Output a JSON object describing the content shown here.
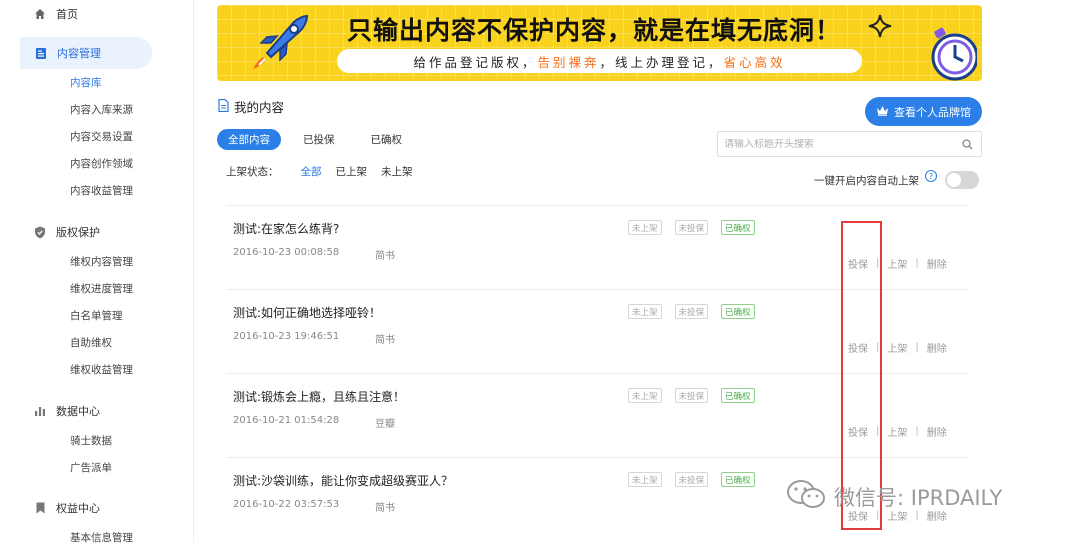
{
  "sidebar": {
    "groups": [
      {
        "label": "首页",
        "icon": "home-icon",
        "items": []
      },
      {
        "label": "内容管理",
        "icon": "document-icon",
        "active": true,
        "items": [
          "内容库",
          "内容入库来源",
          "内容交易设置",
          "内容创作领域",
          "内容收益管理"
        ]
      },
      {
        "label": "版权保护",
        "icon": "shield-icon",
        "items": [
          "维权内容管理",
          "维权进度管理",
          "白名单管理",
          "自助维权",
          "维权收益管理"
        ]
      },
      {
        "label": "数据中心",
        "icon": "bar-chart-icon",
        "items": [
          "骑士数据",
          "广告派单"
        ]
      },
      {
        "label": "权益中心",
        "icon": "bookmark-icon",
        "items": [
          "基本信息管理"
        ]
      }
    ],
    "active_item": "内容库"
  },
  "banner": {
    "title": "只输出内容不保护内容，就是在填无底洞！",
    "pill_parts": [
      "给作品登记版权，",
      "告别裸奔",
      "，线上办理登记，",
      "省心高效"
    ],
    "accent_color": "#f5701b",
    "bg_color": "#f8d21d"
  },
  "header": {
    "title": "我的内容",
    "brand_button": "查看个人品牌馆"
  },
  "tabs": [
    "全部内容",
    "已投保",
    "已确权"
  ],
  "search": {
    "placeholder": "请输入标题开头搜索"
  },
  "filter": {
    "label": "上架状态：",
    "options": [
      "全部",
      "已上架",
      "未上架"
    ]
  },
  "auto_shelf": {
    "label": "一键开启内容自动上架",
    "enabled": false
  },
  "rows": [
    {
      "title": "测试:在家怎么练背?",
      "date": "2016-10-23 00:08:58",
      "author": "简书",
      "tags": [
        "未上架",
        "未投保",
        "已确权"
      ],
      "actions": [
        "投保",
        "上架",
        "删除"
      ]
    },
    {
      "title": "测试:如何正确地选择哑铃！",
      "date": "2016-10-23 19:46:51",
      "author": "简书",
      "tags": [
        "未上架",
        "未投保",
        "已确权"
      ],
      "actions": [
        "投保",
        "上架",
        "删除"
      ]
    },
    {
      "title": "测试:锻炼会上瘾，且练且注意！",
      "date": "2016-10-21 01:54:28",
      "author": "豆瓣",
      "tags": [
        "未上架",
        "未投保",
        "已确权"
      ],
      "actions": [
        "投保",
        "上架",
        "删除"
      ]
    },
    {
      "title": "测试:沙袋训练，能让你变成超级赛亚人？",
      "date": "2016-10-22 03:57:53",
      "author": "简书",
      "tags": [
        "未上架",
        "未投保",
        "已确权"
      ],
      "actions": [
        "投保",
        "上架",
        "删除"
      ]
    }
  ],
  "watermark": "微信号: IPRDAILY",
  "colors": {
    "primary": "#2b7fe6",
    "highlight": "#e23b3b",
    "success": "#4caf50"
  }
}
